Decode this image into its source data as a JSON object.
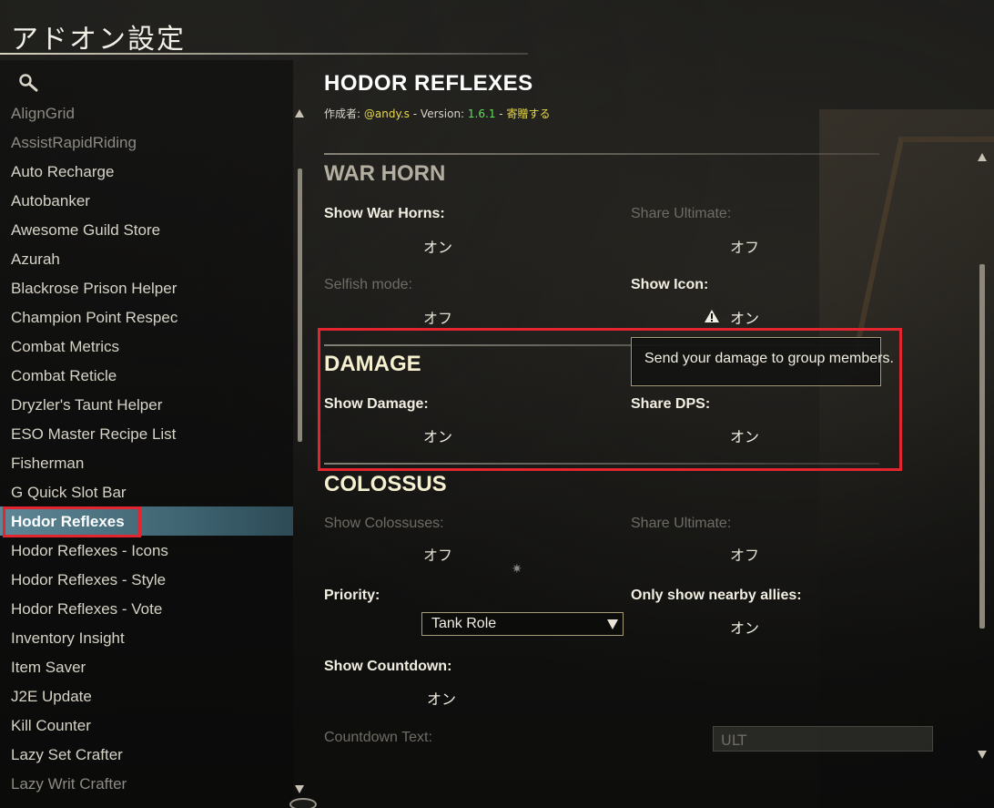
{
  "header": {
    "title": "アドオン設定"
  },
  "sidebar": {
    "search_icon": "search-icon",
    "items": [
      {
        "label": "AlignGrid",
        "state": "dim"
      },
      {
        "label": "AssistRapidRiding",
        "state": "dim"
      },
      {
        "label": "Auto Recharge",
        "state": "normal"
      },
      {
        "label": "Autobanker",
        "state": "normal"
      },
      {
        "label": "Awesome Guild Store",
        "state": "normal"
      },
      {
        "label": "Azurah",
        "state": "normal"
      },
      {
        "label": "Blackrose Prison Helper",
        "state": "normal"
      },
      {
        "label": "Champion Point Respec",
        "state": "normal"
      },
      {
        "label": "Combat Metrics",
        "state": "normal"
      },
      {
        "label": "Combat Reticle",
        "state": "normal"
      },
      {
        "label": "Dryzler's Taunt Helper",
        "state": "normal"
      },
      {
        "label": "ESO Master Recipe List",
        "state": "normal"
      },
      {
        "label": "Fisherman",
        "state": "normal"
      },
      {
        "label": "G Quick Slot Bar",
        "state": "normal"
      },
      {
        "label": "Hodor Reflexes",
        "state": "selected"
      },
      {
        "label": "Hodor Reflexes - Icons",
        "state": "normal"
      },
      {
        "label": "Hodor Reflexes - Style",
        "state": "normal"
      },
      {
        "label": "Hodor Reflexes - Vote",
        "state": "normal"
      },
      {
        "label": "Inventory Insight",
        "state": "normal"
      },
      {
        "label": "Item Saver",
        "state": "normal"
      },
      {
        "label": "J2E Update",
        "state": "normal"
      },
      {
        "label": "Kill Counter",
        "state": "normal"
      },
      {
        "label": "Lazy Set Crafter",
        "state": "normal"
      },
      {
        "label": "Lazy Writ Crafter",
        "state": "dim"
      }
    ]
  },
  "addon": {
    "title": "HODOR REFLEXES",
    "author_label": "作成者:",
    "author": "@andy.s",
    "sep1": "-",
    "version_label": "Version:",
    "version": "1.6.1",
    "sep2": "-",
    "donate": "寄贈する"
  },
  "sections": {
    "war_horn": {
      "title": "WAR HORN",
      "show_war_horns": {
        "label": "Show War Horns:",
        "value": "オン"
      },
      "share_ultimate": {
        "label": "Share Ultimate:",
        "value": "オフ"
      },
      "selfish_mode": {
        "label": "Selfish mode:",
        "value": "オフ"
      },
      "show_icon": {
        "label": "Show Icon:",
        "value": "オン",
        "icon": "warning-icon"
      }
    },
    "damage": {
      "title": "DAMAGE",
      "show_damage": {
        "label": "Show Damage:",
        "value": "オン"
      },
      "share_dps": {
        "label": "Share DPS:",
        "value": "オン"
      },
      "tooltip": "Send your damage to group members."
    },
    "colossus": {
      "title": "COLOSSUS",
      "show_colossuses": {
        "label": "Show Colossuses:",
        "value": "オフ"
      },
      "share_ultimate": {
        "label": "Share Ultimate:",
        "value": "オフ"
      },
      "priority": {
        "label": "Priority:",
        "value": "Tank Role"
      },
      "only_nearby": {
        "label": "Only show nearby allies:",
        "value": "オン"
      },
      "show_countdown": {
        "label": "Show Countdown:",
        "value": "オン"
      },
      "countdown_text": {
        "label": "Countdown Text:",
        "value": "ULT"
      }
    }
  },
  "colors": {
    "highlight_red": "#e32530",
    "selected_row": "#5e8796",
    "author_yellow": "#e8d84a",
    "version_green": "#5fe05f"
  }
}
